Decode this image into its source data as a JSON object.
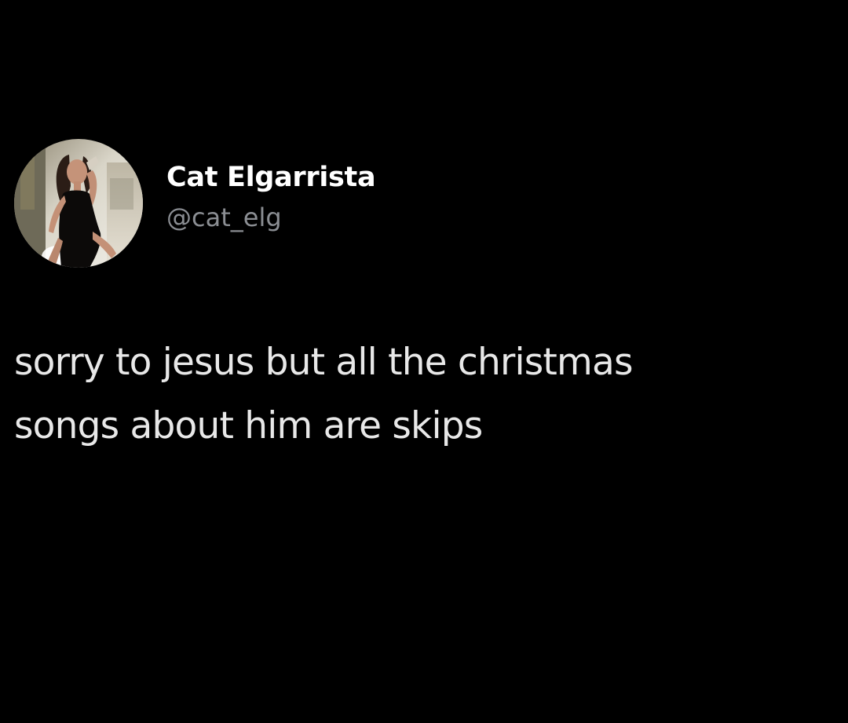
{
  "tweet": {
    "author": {
      "display_name": "Cat Elgarrista",
      "handle": "@cat_elg",
      "avatar": "profile-photo"
    },
    "text": "sorry to jesus but all the christmas\nsongs about him are skips"
  },
  "colors": {
    "background": "#000000",
    "display_name": "#ffffff",
    "handle": "#8b8e93",
    "body_text": "#e8e8e8"
  }
}
